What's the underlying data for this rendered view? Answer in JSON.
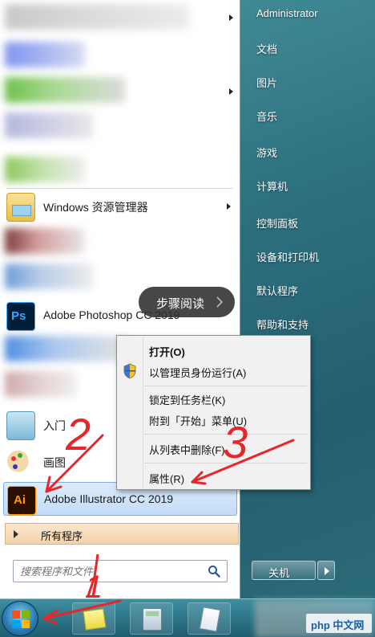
{
  "right_panel": {
    "items": [
      {
        "label": "Administrator"
      },
      {
        "label": "文档"
      },
      {
        "label": "图片"
      },
      {
        "label": "音乐"
      },
      {
        "label": "游戏"
      },
      {
        "label": "计算机"
      },
      {
        "label": "控制面板"
      },
      {
        "label": "设备和打印机"
      },
      {
        "label": "默认程序"
      },
      {
        "label": "帮助和支持"
      }
    ],
    "shutdown_label": "关机"
  },
  "programs": {
    "items": [
      {
        "label": "Windows 资源管理器",
        "icon": "explorer-icon"
      },
      {
        "label": "Adobe Photoshop CC 2019",
        "icon": "photoshop-icon",
        "icon_text": "Ps"
      },
      {
        "label": "入门",
        "icon": "getting-started-icon"
      },
      {
        "label": "画图",
        "icon": "paint-icon"
      },
      {
        "label": "Adobe Illustrator CC 2019",
        "icon": "illustrator-icon",
        "icon_text": "Ai"
      }
    ],
    "all_programs_label": "所有程序"
  },
  "search": {
    "placeholder": "搜索程序和文件"
  },
  "context_menu": {
    "open": "打开(O)",
    "run_as_admin": "以管理员身份运行(A)",
    "pin_taskbar": "锁定到任务栏(K)",
    "pin_start": "附到「开始」菜单(U)",
    "remove_list": "从列表中删除(F)",
    "properties": "属性(R)"
  },
  "tooltip": {
    "label": "步骤阅读"
  },
  "annotations": {
    "step1": "1",
    "step2": "2",
    "step3": "3",
    "color": "#e8262a"
  },
  "watermark": {
    "label": "php 中文网"
  },
  "colors": {
    "illustrator_bg": "#2b0f02",
    "illustrator_fg": "#ff9a00",
    "photoshop_bg": "#001e36",
    "photoshop_fg": "#31a8ff"
  }
}
